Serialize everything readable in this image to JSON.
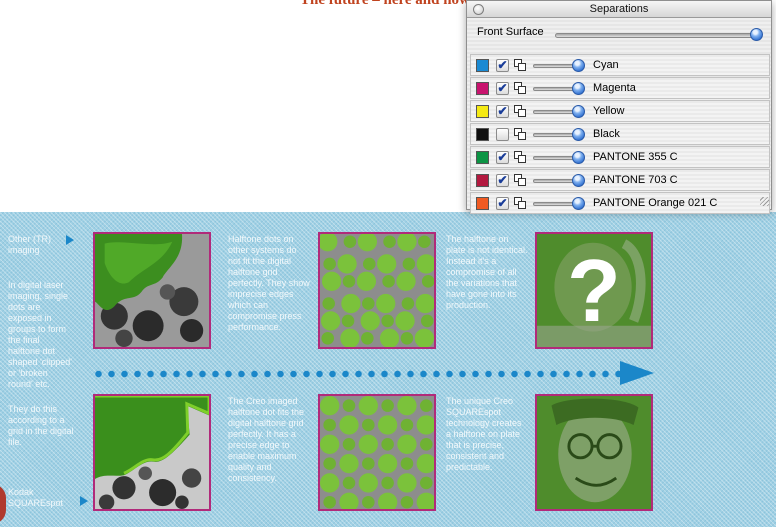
{
  "document": {
    "title_fragment": "The future – here and now",
    "left_labels": {
      "top": "Other (TR) imaging",
      "bottom": "Kodak SQUAREspot"
    },
    "column_texts": {
      "left_top": "In digital laser imaging, single dots are exposed in groups to form the final halftone dot shaped 'clipped' or 'broken round' etc.",
      "left_bottom": "They do this according to a grid in the digital file.",
      "mid_top": "Halftone dots on other systems do not fit the digital halftone grid perfectly. They show imprecise edges which can compromise press performance.",
      "mid_bottom": "The Creo imaged halftone dot fits the digital halftone grid perfectly. It has a precise edge to enable maximum quality and consistency.",
      "right_top": "The halftone on plate is not identical. Instead it's a compromise of all the variations that have gone into its production.",
      "right_bottom": "The unique Creo SQUAREspot technology creates a halftone on plate that is precise, consistent and predictable."
    },
    "question_mark": "?"
  },
  "palette": {
    "title": "Separations",
    "front_surface_label": "Front Surface",
    "front_surface_level": 1.0,
    "separations": [
      {
        "name": "Cyan",
        "color": "#1a8ad3",
        "checked": true,
        "level": 1.0
      },
      {
        "name": "Magenta",
        "color": "#c8146e",
        "checked": true,
        "level": 1.0
      },
      {
        "name": "Yellow",
        "color": "#f5ea14",
        "checked": true,
        "level": 1.0
      },
      {
        "name": "Black",
        "color": "#111111",
        "checked": false,
        "level": 1.0
      },
      {
        "name": "PANTONE 355 C",
        "color": "#0c9444",
        "checked": true,
        "level": 1.0
      },
      {
        "name": "PANTONE 703 C",
        "color": "#b3193f",
        "checked": true,
        "level": 1.0
      },
      {
        "name": "PANTONE Orange 021 C",
        "color": "#f05a22",
        "checked": true,
        "level": 1.0
      }
    ]
  }
}
